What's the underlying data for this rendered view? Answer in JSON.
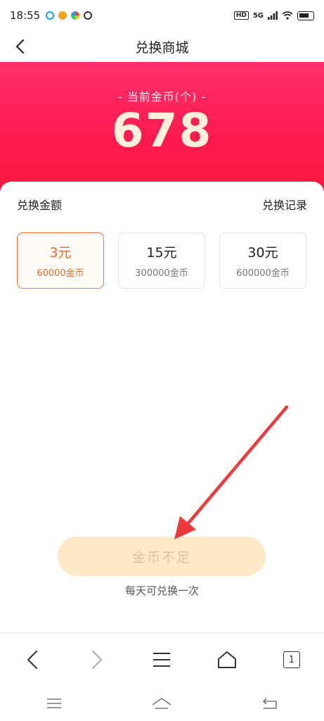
{
  "status_bar": {
    "time": "18:55",
    "hd": "HD",
    "network": "5G"
  },
  "header": {
    "title": "兑换商城"
  },
  "hero": {
    "label": "- 当前金币(个) -",
    "coins": "678"
  },
  "exchange": {
    "section_title": "兑换金额",
    "record_link": "兑换记录",
    "options": [
      {
        "amount": "3元",
        "coins": "60000金币",
        "selected": true
      },
      {
        "amount": "15元",
        "coins": "300000金币",
        "selected": false
      },
      {
        "amount": "30元",
        "coins": "600000金币",
        "selected": false
      }
    ],
    "button_label": "金币不足",
    "tip": "每天可兑换一次"
  },
  "browser_bar": {
    "tab_count": "1"
  },
  "colors": {
    "hero_red": "#ff1a4e",
    "accent_orange": "#e07130",
    "button_disabled_bg": "#fde9c9",
    "annotation_arrow": "#ee3a3a"
  }
}
